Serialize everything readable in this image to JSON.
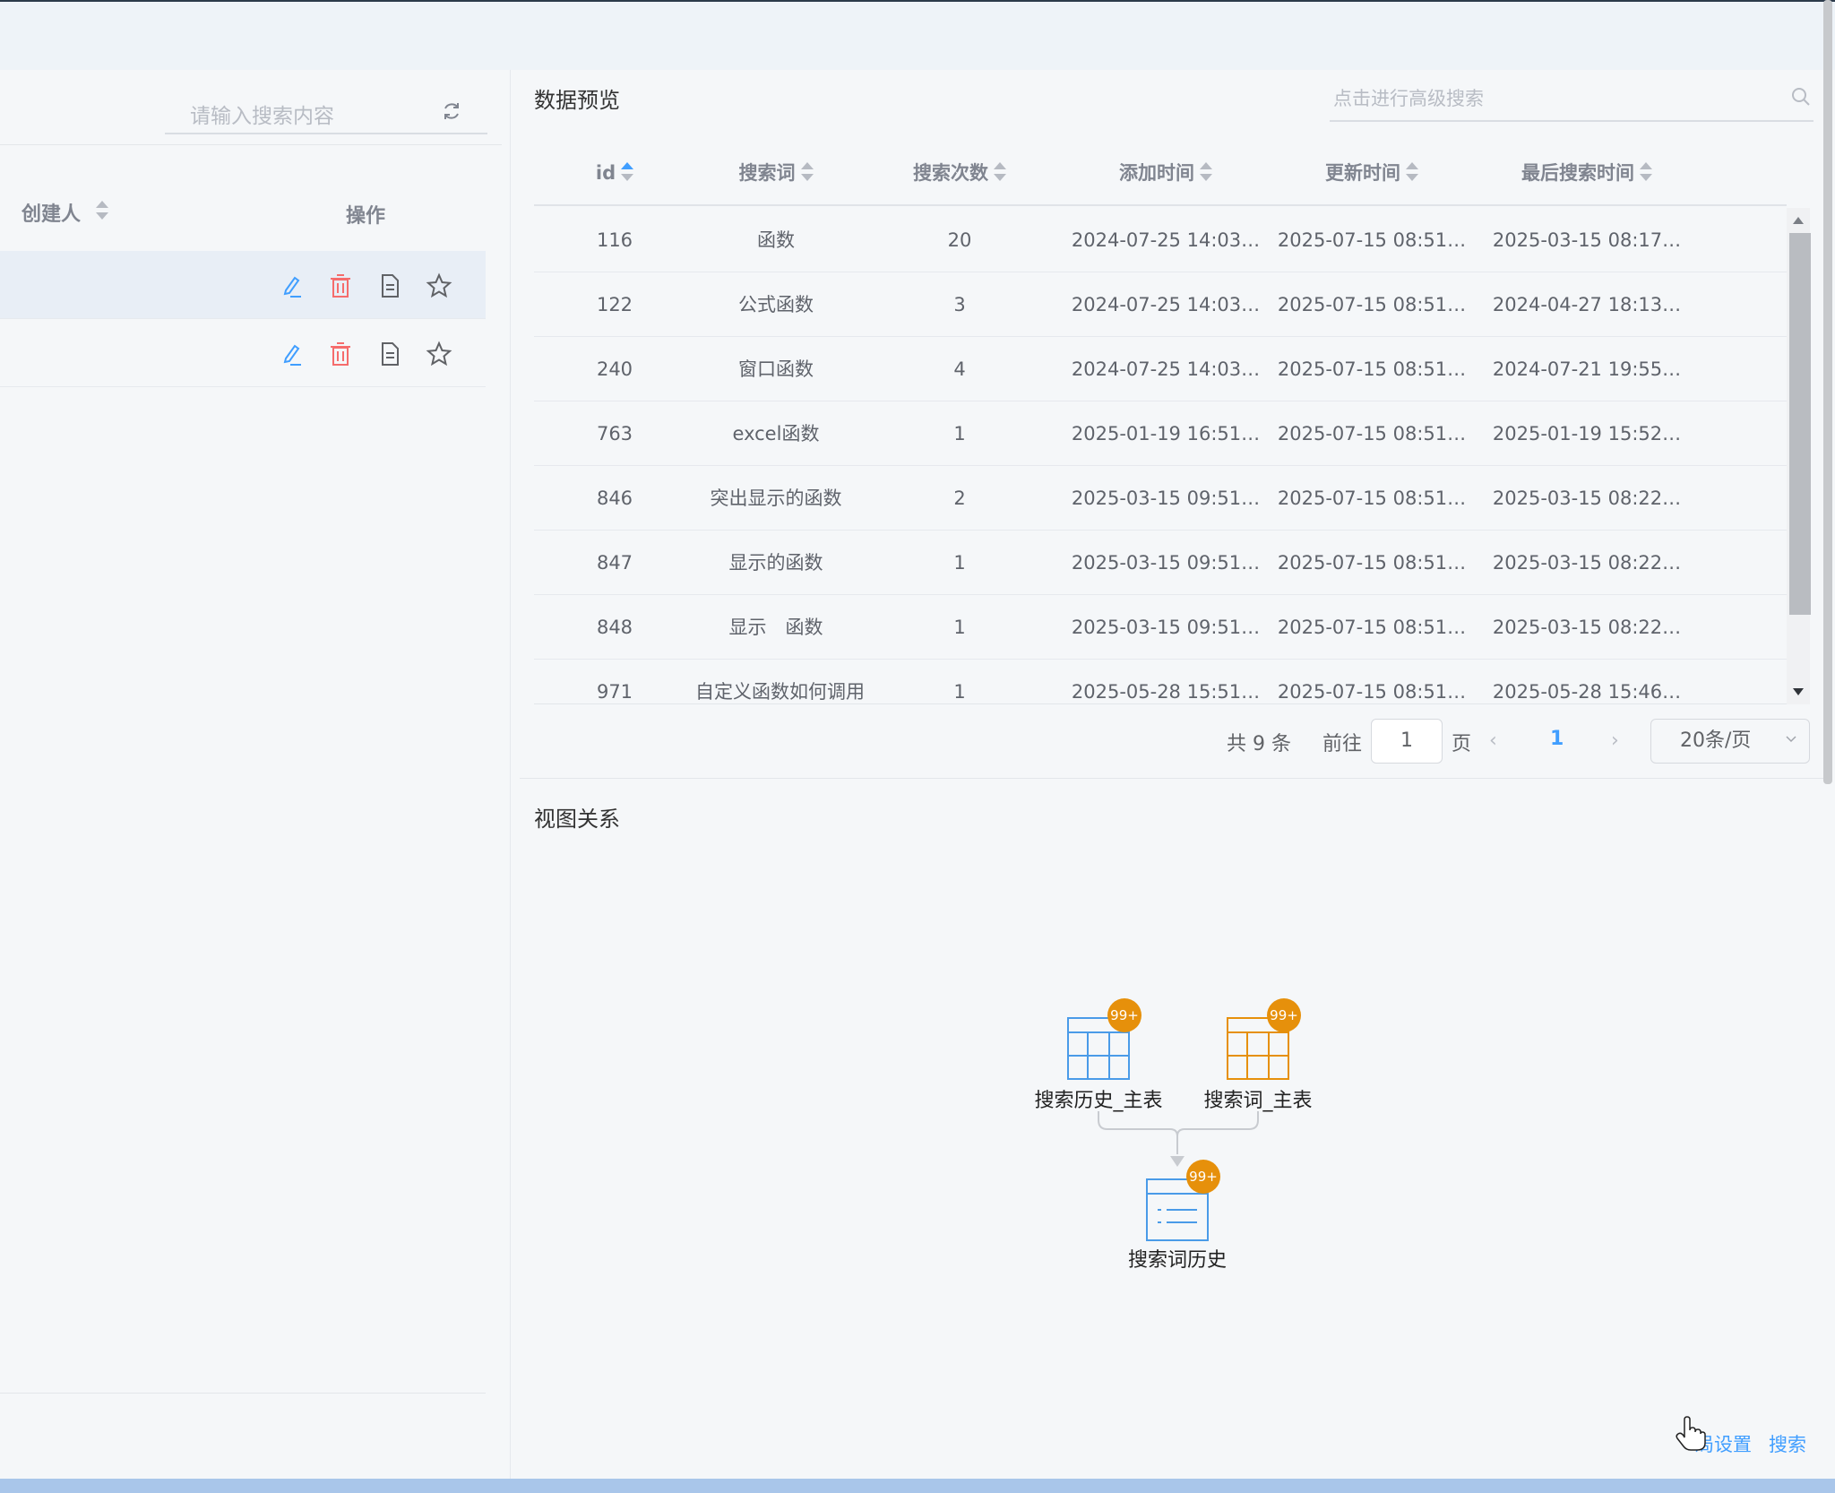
{
  "left_panel": {
    "search_placeholder": "请输入搜索内容",
    "columns": {
      "creator": "创建人",
      "actions": "操作"
    },
    "rows": [
      {
        "selected": true,
        "actions": [
          "edit-icon",
          "delete-icon",
          "document-icon",
          "star-icon"
        ]
      },
      {
        "selected": false,
        "actions": [
          "edit-icon",
          "delete-icon",
          "document-icon",
          "star-icon"
        ]
      }
    ]
  },
  "preview": {
    "title": "数据预览",
    "search_placeholder": "点击进行高级搜索",
    "columns": [
      "id",
      "搜索词",
      "搜索次数",
      "添加时间",
      "更新时间",
      "最后搜索时间"
    ],
    "sort_active_column": "id",
    "rows": [
      [
        "116",
        "函数",
        "20",
        "2024-07-25 14:03…",
        "2025-07-15 08:51…",
        "2025-03-15 08:17…"
      ],
      [
        "122",
        "公式函数",
        "3",
        "2024-07-25 14:03…",
        "2025-07-15 08:51…",
        "2024-04-27 18:13…"
      ],
      [
        "240",
        "窗口函数",
        "4",
        "2024-07-25 14:03…",
        "2025-07-15 08:51…",
        "2024-07-21 19:55…"
      ],
      [
        "763",
        "excel函数",
        "1",
        "2025-01-19 16:51…",
        "2025-07-15 08:51…",
        "2025-01-19 15:52…"
      ],
      [
        "846",
        "突出显示的函数",
        "2",
        "2025-03-15 09:51…",
        "2025-07-15 08:51…",
        "2025-03-15 08:22…"
      ],
      [
        "847",
        "显示的函数",
        "1",
        "2025-03-15 09:51…",
        "2025-07-15 08:51…",
        "2025-03-15 08:22…"
      ],
      [
        "848",
        "显示　函数",
        "1",
        "2025-03-15 09:51…",
        "2025-07-15 08:51…",
        "2025-03-15 08:22…"
      ],
      [
        "971",
        "自定义函数如何调用",
        "1",
        "2025-05-28 15:51…",
        "2025-07-15 08:51…",
        "2025-05-28 15:46…"
      ]
    ],
    "pagination": {
      "total": "共 9 条",
      "goto_label": "前往",
      "goto_value": "1",
      "page_suffix": "页",
      "prev": "‹",
      "current_page": "1",
      "next": "›",
      "page_size": "20条/页"
    }
  },
  "relation": {
    "title": "视图关系",
    "nodes": [
      {
        "label": "搜索历史_主表",
        "badge": "99+",
        "color": "#4a9be8"
      },
      {
        "label": "搜索词_主表",
        "badge": "99+",
        "color": "#e6900b"
      },
      {
        "label": "搜索词历史",
        "badge": "99+",
        "color": "#4a9be8"
      }
    ]
  },
  "footer_links": {
    "global_settings": "局设置",
    "search": "搜索"
  },
  "colors": {
    "accent": "#409eff",
    "danger": "#f56c6c",
    "badge": "#e6900b"
  }
}
